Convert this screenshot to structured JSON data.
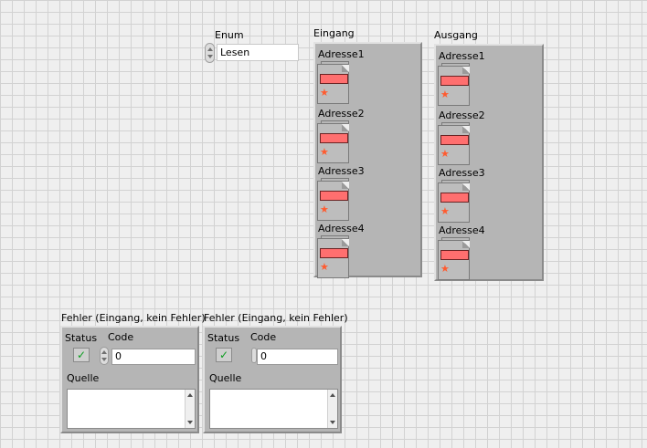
{
  "enum": {
    "label": "Enum",
    "value": "Lesen"
  },
  "eingang": {
    "label": "Eingang",
    "items": [
      {
        "label": "Adresse1"
      },
      {
        "label": "Adresse2"
      },
      {
        "label": "Adresse3"
      },
      {
        "label": "Adresse4"
      }
    ]
  },
  "ausgang": {
    "label": "Ausgang",
    "items": [
      {
        "label": "Adresse1"
      },
      {
        "label": "Adresse2"
      },
      {
        "label": "Adresse3"
      },
      {
        "label": "Adresse4"
      }
    ]
  },
  "error_clusters": [
    {
      "label": "Fehler (Eingang, kein Fehler)",
      "status_label": "Status",
      "code_label": "Code",
      "code_value": "0",
      "source_label": "Quelle",
      "status_glyph": "✓"
    },
    {
      "label": "Fehler (Eingang, kein Fehler)",
      "status_label": "Status",
      "code_label": "Code",
      "code_value": "0",
      "source_label": "Quelle",
      "status_glyph": "✓"
    }
  ],
  "colors": {
    "led_off": "#ff6f6f",
    "panel": "#b5b5b5",
    "grid_bg": "#efefef"
  }
}
